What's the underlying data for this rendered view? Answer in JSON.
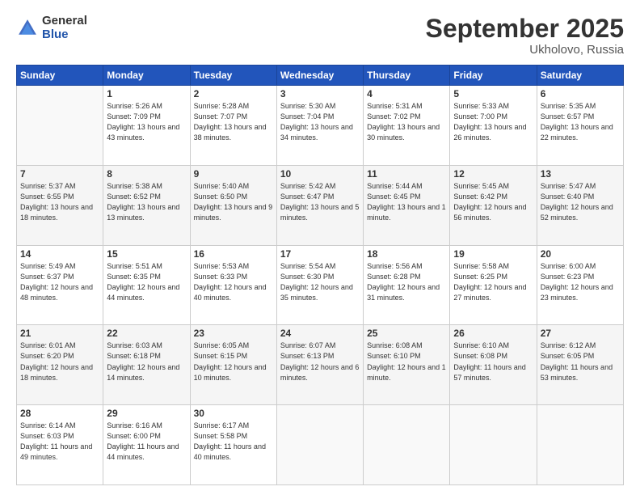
{
  "header": {
    "logo_general": "General",
    "logo_blue": "Blue",
    "month": "September 2025",
    "location": "Ukholovo, Russia"
  },
  "days_of_week": [
    "Sunday",
    "Monday",
    "Tuesday",
    "Wednesday",
    "Thursday",
    "Friday",
    "Saturday"
  ],
  "weeks": [
    [
      {
        "day": "",
        "info": ""
      },
      {
        "day": "1",
        "info": "Sunrise: 5:26 AM\nSunset: 7:09 PM\nDaylight: 13 hours\nand 43 minutes."
      },
      {
        "day": "2",
        "info": "Sunrise: 5:28 AM\nSunset: 7:07 PM\nDaylight: 13 hours\nand 38 minutes."
      },
      {
        "day": "3",
        "info": "Sunrise: 5:30 AM\nSunset: 7:04 PM\nDaylight: 13 hours\nand 34 minutes."
      },
      {
        "day": "4",
        "info": "Sunrise: 5:31 AM\nSunset: 7:02 PM\nDaylight: 13 hours\nand 30 minutes."
      },
      {
        "day": "5",
        "info": "Sunrise: 5:33 AM\nSunset: 7:00 PM\nDaylight: 13 hours\nand 26 minutes."
      },
      {
        "day": "6",
        "info": "Sunrise: 5:35 AM\nSunset: 6:57 PM\nDaylight: 13 hours\nand 22 minutes."
      }
    ],
    [
      {
        "day": "7",
        "info": "Sunrise: 5:37 AM\nSunset: 6:55 PM\nDaylight: 13 hours\nand 18 minutes."
      },
      {
        "day": "8",
        "info": "Sunrise: 5:38 AM\nSunset: 6:52 PM\nDaylight: 13 hours\nand 13 minutes."
      },
      {
        "day": "9",
        "info": "Sunrise: 5:40 AM\nSunset: 6:50 PM\nDaylight: 13 hours\nand 9 minutes."
      },
      {
        "day": "10",
        "info": "Sunrise: 5:42 AM\nSunset: 6:47 PM\nDaylight: 13 hours\nand 5 minutes."
      },
      {
        "day": "11",
        "info": "Sunrise: 5:44 AM\nSunset: 6:45 PM\nDaylight: 13 hours\nand 1 minute."
      },
      {
        "day": "12",
        "info": "Sunrise: 5:45 AM\nSunset: 6:42 PM\nDaylight: 12 hours\nand 56 minutes."
      },
      {
        "day": "13",
        "info": "Sunrise: 5:47 AM\nSunset: 6:40 PM\nDaylight: 12 hours\nand 52 minutes."
      }
    ],
    [
      {
        "day": "14",
        "info": "Sunrise: 5:49 AM\nSunset: 6:37 PM\nDaylight: 12 hours\nand 48 minutes."
      },
      {
        "day": "15",
        "info": "Sunrise: 5:51 AM\nSunset: 6:35 PM\nDaylight: 12 hours\nand 44 minutes."
      },
      {
        "day": "16",
        "info": "Sunrise: 5:53 AM\nSunset: 6:33 PM\nDaylight: 12 hours\nand 40 minutes."
      },
      {
        "day": "17",
        "info": "Sunrise: 5:54 AM\nSunset: 6:30 PM\nDaylight: 12 hours\nand 35 minutes."
      },
      {
        "day": "18",
        "info": "Sunrise: 5:56 AM\nSunset: 6:28 PM\nDaylight: 12 hours\nand 31 minutes."
      },
      {
        "day": "19",
        "info": "Sunrise: 5:58 AM\nSunset: 6:25 PM\nDaylight: 12 hours\nand 27 minutes."
      },
      {
        "day": "20",
        "info": "Sunrise: 6:00 AM\nSunset: 6:23 PM\nDaylight: 12 hours\nand 23 minutes."
      }
    ],
    [
      {
        "day": "21",
        "info": "Sunrise: 6:01 AM\nSunset: 6:20 PM\nDaylight: 12 hours\nand 18 minutes."
      },
      {
        "day": "22",
        "info": "Sunrise: 6:03 AM\nSunset: 6:18 PM\nDaylight: 12 hours\nand 14 minutes."
      },
      {
        "day": "23",
        "info": "Sunrise: 6:05 AM\nSunset: 6:15 PM\nDaylight: 12 hours\nand 10 minutes."
      },
      {
        "day": "24",
        "info": "Sunrise: 6:07 AM\nSunset: 6:13 PM\nDaylight: 12 hours\nand 6 minutes."
      },
      {
        "day": "25",
        "info": "Sunrise: 6:08 AM\nSunset: 6:10 PM\nDaylight: 12 hours\nand 1 minute."
      },
      {
        "day": "26",
        "info": "Sunrise: 6:10 AM\nSunset: 6:08 PM\nDaylight: 11 hours\nand 57 minutes."
      },
      {
        "day": "27",
        "info": "Sunrise: 6:12 AM\nSunset: 6:05 PM\nDaylight: 11 hours\nand 53 minutes."
      }
    ],
    [
      {
        "day": "28",
        "info": "Sunrise: 6:14 AM\nSunset: 6:03 PM\nDaylight: 11 hours\nand 49 minutes."
      },
      {
        "day": "29",
        "info": "Sunrise: 6:16 AM\nSunset: 6:00 PM\nDaylight: 11 hours\nand 44 minutes."
      },
      {
        "day": "30",
        "info": "Sunrise: 6:17 AM\nSunset: 5:58 PM\nDaylight: 11 hours\nand 40 minutes."
      },
      {
        "day": "",
        "info": ""
      },
      {
        "day": "",
        "info": ""
      },
      {
        "day": "",
        "info": ""
      },
      {
        "day": "",
        "info": ""
      }
    ]
  ]
}
